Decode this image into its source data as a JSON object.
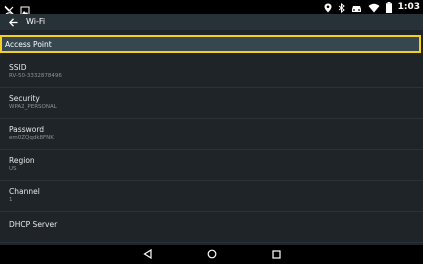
{
  "status_bar": {
    "time": "1:03",
    "left_icons": [
      "missed-call-icon",
      "image-icon"
    ],
    "right_icons": [
      "location-icon",
      "bluetooth-icon",
      "car-icon",
      "wifi-icon",
      "battery-icon"
    ]
  },
  "app_bar": {
    "title": "Wi-Fi",
    "back_icon": "arrow-back-icon"
  },
  "section": {
    "label": "Access Point",
    "highlight_color": "#f5d020"
  },
  "settings": [
    {
      "title": "SSID",
      "value": "RV-50-3332878496"
    },
    {
      "title": "Security",
      "value": "WPA2_PERSONAL"
    },
    {
      "title": "Password",
      "value": "em0ZQqdk8FNK"
    },
    {
      "title": "Region",
      "value": "US"
    },
    {
      "title": "Channel",
      "value": "1"
    },
    {
      "title": "DHCP Server",
      "value": ""
    }
  ],
  "nav_bar": {
    "icons": [
      "back-triangle-icon",
      "home-circle-icon",
      "recents-square-icon"
    ]
  }
}
